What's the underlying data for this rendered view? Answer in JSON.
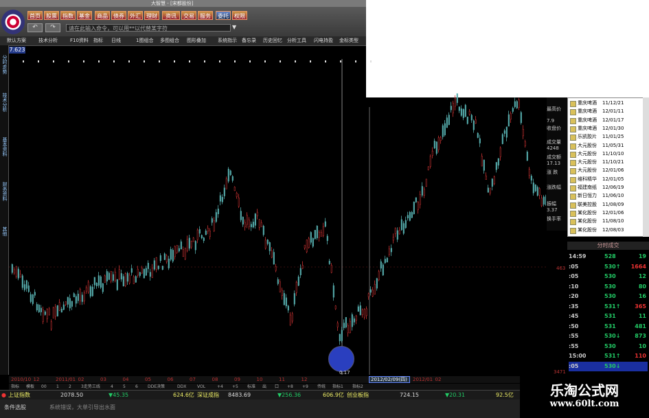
{
  "app": {
    "title": "大智慧 - [宋都股份]"
  },
  "toolbar": {
    "buttons": [
      "首页",
      "股票",
      "指数",
      "基金",
      "商品",
      "债券",
      "外汇",
      "理财",
      "资讯",
      "交易",
      "服务",
      "委托",
      "权限"
    ],
    "command_placeholder": "请在此输入命令，可以用**以代替某字符"
  },
  "menu": [
    "默认方案",
    "技术分析",
    "F10资料",
    "指标",
    "日线",
    "1图组合",
    "多图组合",
    "图形叠加",
    "系统指示",
    "备忘录",
    "历史回忆",
    "分析工具",
    "闪电持盈",
    "金标类型"
  ],
  "left_tabs": [
    "分时走势",
    "技术分析",
    "基本资料",
    "财务资料",
    "其他"
  ],
  "price_label": "7.623",
  "chart_data": {
    "type": "candlestick",
    "x_ticks": [
      "2010/10",
      "12",
      "2011/01",
      "02",
      "03",
      "04",
      "05",
      "06",
      "07",
      "08",
      "09",
      "10",
      "11",
      "12",
      "2012/01",
      "02"
    ],
    "selected_date": "2012/02/09(四)",
    "low_marker": "0.17",
    "price_levels": [
      "463",
      "3471"
    ]
  },
  "sub_tabs": [
    "指标",
    "模板",
    "00",
    "1",
    "2",
    "3走势三线",
    "4",
    "5",
    "6",
    "DDE决策",
    "DDX",
    "VOL",
    "+4",
    "+5",
    "标准",
    "出",
    "口",
    "+8",
    "+9",
    "传统",
    "指标1",
    "指标2"
  ],
  "index_bar": {
    "items": [
      {
        "name": "上证指数",
        "value": "2078.50",
        "change": "▼45.35",
        "amount": "624.6亿"
      },
      {
        "name": "深证成指",
        "value": "8483.69",
        "change": "▼256.36",
        "amount": "606.9亿"
      },
      {
        "name": "创业板指",
        "value": "724.15",
        "change": "▼20.31",
        "amount": "92.5亿"
      }
    ]
  },
  "status": {
    "left": "条件选股",
    "msg": "系统错误，大单引导出水面"
  },
  "stock_info": {
    "labels": [
      "最高价",
      "收盘价",
      "成交量",
      "成交额",
      "涨  跌",
      "涨跌幅",
      "振幅",
      "换手率"
    ],
    "values": [
      "7.9",
      "4248",
      "17.13",
      "3.37"
    ]
  },
  "stock_list": [
    {
      "name": "重庆啤酒",
      "date": "11/12/21"
    },
    {
      "name": "重庆啤酒",
      "date": "12/01/11"
    },
    {
      "name": "重庆啤酒",
      "date": "12/01/17"
    },
    {
      "name": "重庆啤酒",
      "date": "12/01/30"
    },
    {
      "name": "乐凯胶片",
      "date": "11/01/25"
    },
    {
      "name": "大元股份",
      "date": "11/05/31"
    },
    {
      "name": "大元股份",
      "date": "11/10/10"
    },
    {
      "name": "大元股份",
      "date": "11/10/21"
    },
    {
      "name": "大元股份",
      "date": "12/01/06"
    },
    {
      "name": "维科精华",
      "date": "12/01/05"
    },
    {
      "name": "福建南纸",
      "date": "12/06/19"
    },
    {
      "name": "新日恒力",
      "date": "11/06/10"
    },
    {
      "name": "联美控股",
      "date": "11/08/09"
    },
    {
      "name": "某化股份",
      "date": "12/01/06"
    },
    {
      "name": "某化股份",
      "date": "11/08/10"
    },
    {
      "name": "某化股份",
      "date": "12/08/03"
    }
  ],
  "ticks": {
    "header": "分时成交",
    "rows": [
      {
        "time": "14:59",
        "price": "528",
        "vol": "19",
        "dir": ""
      },
      {
        "time": ":05",
        "price": "530↑",
        "vol": "1664",
        "dir": "red"
      },
      {
        "time": ":05",
        "price": "530",
        "vol": "12",
        "dir": ""
      },
      {
        "time": ":10",
        "price": "530",
        "vol": "80",
        "dir": ""
      },
      {
        "time": ":20",
        "price": "530",
        "vol": "16",
        "dir": ""
      },
      {
        "time": ":35",
        "price": "531↑",
        "vol": "365",
        "dir": "red"
      },
      {
        "time": ":45",
        "price": "531",
        "vol": "11",
        "dir": ""
      },
      {
        "time": ":50",
        "price": "531",
        "vol": "481",
        "dir": ""
      },
      {
        "time": ":55",
        "price": "530↓",
        "vol": "873",
        "dir": ""
      },
      {
        "time": ":55",
        "price": "530",
        "vol": "10",
        "dir": ""
      },
      {
        "time": "15:00",
        "price": "531↑",
        "vol": "110",
        "dir": "red"
      },
      {
        "time": ":05",
        "price": "530↓",
        "vol": "",
        "dir": ""
      }
    ]
  },
  "watermark": {
    "line1": "乐淘公式网",
    "line2": "www.60lt.com"
  },
  "colors": {
    "up": "#e33",
    "down": "#2c6",
    "accent": "#233a8a"
  }
}
